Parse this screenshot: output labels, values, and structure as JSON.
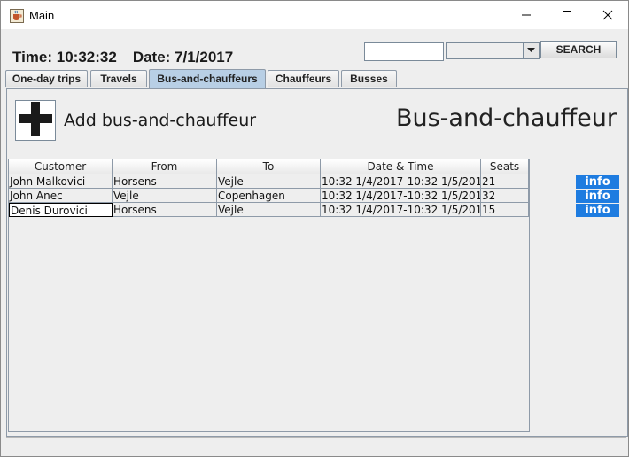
{
  "window": {
    "title": "Main",
    "icon": "java-cup-icon"
  },
  "header": {
    "time_text": "Time: 10:32:32",
    "date_text": "Date: 7/1/2017"
  },
  "search": {
    "input_value": "",
    "combo_value": "",
    "button_label": "SEARCH"
  },
  "tabs": [
    {
      "label": "One-day trips",
      "active": false
    },
    {
      "label": "Travels",
      "active": false
    },
    {
      "label": "Bus-and-chauffeurs",
      "active": true
    },
    {
      "label": "Chauffeurs",
      "active": false
    },
    {
      "label": "Busses",
      "active": false
    }
  ],
  "panel": {
    "add_label": "Add bus-and-chauffeur",
    "heading": "Bus-and-chauffeur"
  },
  "table": {
    "columns": [
      "Customer",
      "From",
      "To",
      "Date & Time",
      "Seats"
    ],
    "rows": [
      {
        "customer": "John Malkovici",
        "from": "Horsens",
        "to": "Vejle",
        "datetime": "10:32 1/4/2017-10:32 1/5/2017",
        "seats": "21",
        "selected": false
      },
      {
        "customer": "John Anec",
        "from": "Vejle",
        "to": "Copenhagen",
        "datetime": "10:32 1/4/2017-10:32 1/5/2017",
        "seats": "32",
        "selected": false
      },
      {
        "customer": "Denis Durovici",
        "from": "Horsens",
        "to": "Vejle",
        "datetime": "10:32 1/4/2017-10:32 1/5/2017",
        "seats": "15",
        "selected": true
      }
    ]
  },
  "info_buttons": [
    "info",
    "info",
    "info"
  ],
  "colors": {
    "selection": "#b8cfe5",
    "info_button": "#1e7ce0",
    "panel_bg": "#eeeeee"
  }
}
